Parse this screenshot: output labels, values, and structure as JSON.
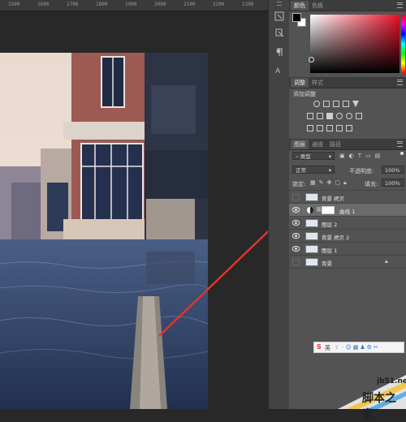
{
  "ruler": {
    "ticks": [
      "1500",
      "1600",
      "1700",
      "1800",
      "1900",
      "2000",
      "2100",
      "2200",
      "2300"
    ]
  },
  "color_panel": {
    "tabs": [
      "颜色",
      "色板"
    ]
  },
  "adjustments_panel": {
    "tabs": [
      "调整",
      "样式"
    ],
    "add_adjustment_label": "添加调整"
  },
  "layers_panel": {
    "tabs": [
      "图层",
      "通道",
      "路径"
    ],
    "filter_kind": "类型",
    "blend_mode": "正常",
    "opacity_label": "不透明度:",
    "opacity_value": "100%",
    "lock_label": "锁定:",
    "fill_label": "填充:",
    "fill_value": "100%",
    "layers": [
      {
        "name": "背景 拷贝",
        "visible": false
      },
      {
        "name": "曲线 1",
        "visible": true,
        "selected": true
      },
      {
        "name": "图层 2",
        "visible": true
      },
      {
        "name": "背景 拷贝 2",
        "visible": true
      },
      {
        "name": "图层 1",
        "visible": true
      },
      {
        "name": "背景",
        "visible": false,
        "locked": true
      }
    ]
  },
  "ime_bar": {
    "brand": "S",
    "lang": "英"
  },
  "watermark": {
    "site": "jb51.net",
    "text": "脚本之家"
  },
  "colors": {
    "annotation_arrow": "#e8322a",
    "panel_bg": "#535353",
    "selected_layer": "#6b6b6b"
  }
}
